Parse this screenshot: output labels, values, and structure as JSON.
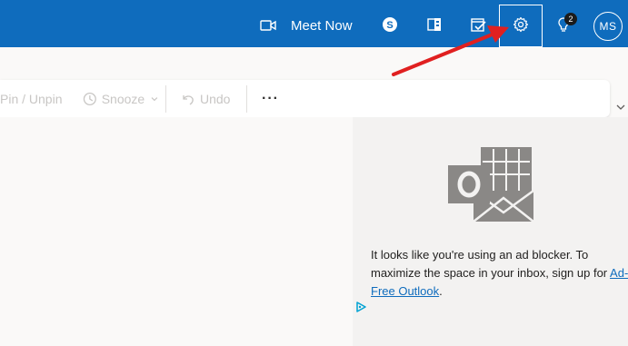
{
  "header": {
    "meet_now_label": "Meet Now",
    "profile_initials": "MS",
    "whats_new_badge": "2",
    "icons": [
      "video-camera-icon",
      "skype-icon",
      "office-apps-icon",
      "to-do-icon",
      "settings-gear-icon",
      "lightbulb-icon"
    ]
  },
  "commandbar": {
    "pin_unpin_label": "Pin / Unpin",
    "snooze_label": "Snooze",
    "undo_label": "Undo",
    "more_label": "···"
  },
  "ad": {
    "message": "It looks like you're using an ad blocker. To maximize the space in your inbox, sign up for",
    "link_label": "Ad-Free Outlook",
    "trailing": "."
  },
  "colors": {
    "header_blue": "#0f6cbd",
    "annotation_red": "#e02020",
    "disabled_text": "#c8c6c4",
    "link_blue": "#0f6cbd"
  }
}
